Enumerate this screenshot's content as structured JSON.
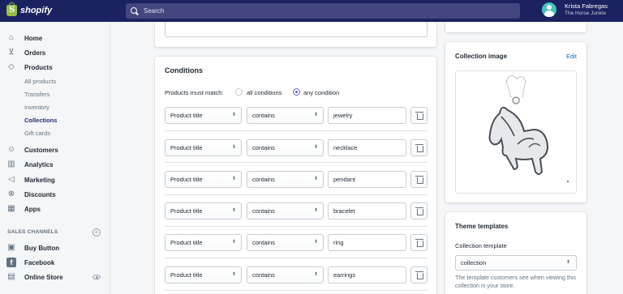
{
  "app": {
    "logo_text": "shopify",
    "brand_color": "#95bf47",
    "topbar_color": "#1c2260"
  },
  "search": {
    "placeholder": "Search"
  },
  "user": {
    "name": "Krista Fabregas",
    "store": "The Horse Junkie"
  },
  "sidebar": {
    "items": [
      {
        "label": "Home",
        "icon": "home-icon"
      },
      {
        "label": "Orders",
        "icon": "orders-icon"
      },
      {
        "label": "Products",
        "icon": "tag-icon"
      },
      {
        "label": "Customers",
        "icon": "person-icon"
      },
      {
        "label": "Analytics",
        "icon": "bar-chart-icon"
      },
      {
        "label": "Marketing",
        "icon": "megaphone-icon"
      },
      {
        "label": "Discounts",
        "icon": "discount-icon"
      },
      {
        "label": "Apps",
        "icon": "apps-icon"
      }
    ],
    "product_subitems": [
      "All products",
      "Transfers",
      "Inventory",
      "Collections",
      "Gift cards"
    ],
    "active_subitem": "Collections",
    "sales_channels_heading": "SALES CHANNELS",
    "channels": [
      {
        "label": "Buy Button",
        "icon": "buy-button-icon"
      },
      {
        "label": "Facebook",
        "icon": "facebook-icon"
      },
      {
        "label": "Online Store",
        "icon": "store-icon"
      }
    ]
  },
  "conditions": {
    "title": "Conditions",
    "must_match_label": "Products must match:",
    "option_all": "all conditions",
    "option_any": "any condition",
    "selected": "any condition",
    "rows": [
      {
        "field": "Product title",
        "operator": "contains",
        "value": "jewelry"
      },
      {
        "field": "Product title",
        "operator": "contains",
        "value": "necklace"
      },
      {
        "field": "Product title",
        "operator": "contains",
        "value": "pendant"
      },
      {
        "field": "Product title",
        "operator": "contains",
        "value": "bracelet"
      },
      {
        "field": "Product title",
        "operator": "contains",
        "value": "ring"
      },
      {
        "field": "Product title",
        "operator": "contains",
        "value": "earrings"
      }
    ]
  },
  "collection_image": {
    "title": "Collection image",
    "edit_label": "Edit"
  },
  "theme_templates": {
    "title": "Theme templates",
    "collection_template_label": "Collection template",
    "collection_template_value": "collection",
    "help_text": "The template customers see when viewing this collection in your store."
  }
}
